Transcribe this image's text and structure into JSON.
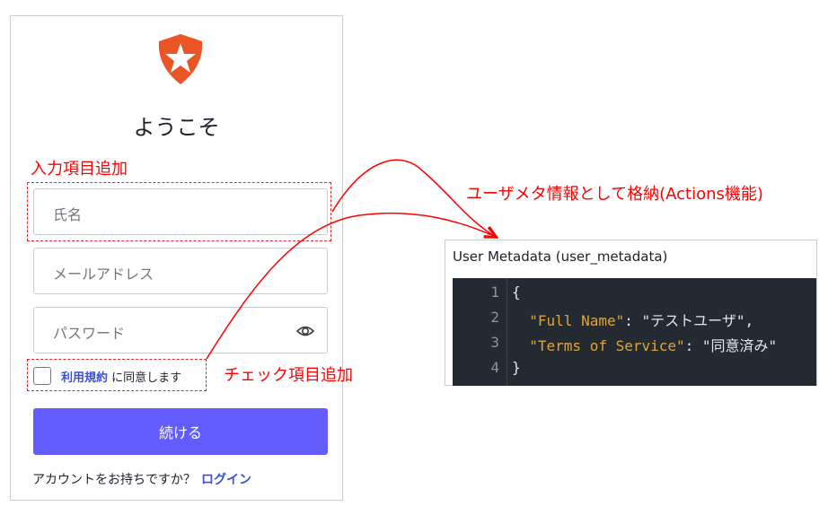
{
  "login": {
    "welcome": "ようこそ",
    "name_placeholder": "氏名",
    "email_placeholder": "メールアドレス",
    "password_placeholder": "パスワード",
    "terms_link": "利用規約",
    "terms_suffix": "に同意します",
    "continue_button": "続ける",
    "footer_text": "アカウントをお持ちですか？",
    "login_link": "ログイン",
    "brand_color": "#eb5424",
    "button_color": "#635dff",
    "icons": [
      "auth0-shield-logo",
      "eye-icon",
      "checkbox-icon"
    ]
  },
  "annotations": {
    "input_added": "入力項目追加",
    "check_added": "チェック項目追加",
    "stored_as": "ユーザメタ情報として格納(Actions機能)",
    "color": "#ff0000"
  },
  "metadata_panel": {
    "title": "User Metadata (user_metadata)",
    "lines": [
      {
        "num": "1",
        "open": "{"
      },
      {
        "num": "2",
        "key": "\"Full Name\"",
        "sep": ": ",
        "value": "\"テストユーザ\","
      },
      {
        "num": "3",
        "key": "\"Terms of Service\"",
        "sep": ": ",
        "value": "\"同意済み\""
      },
      {
        "num": "4",
        "close": "}"
      }
    ]
  }
}
